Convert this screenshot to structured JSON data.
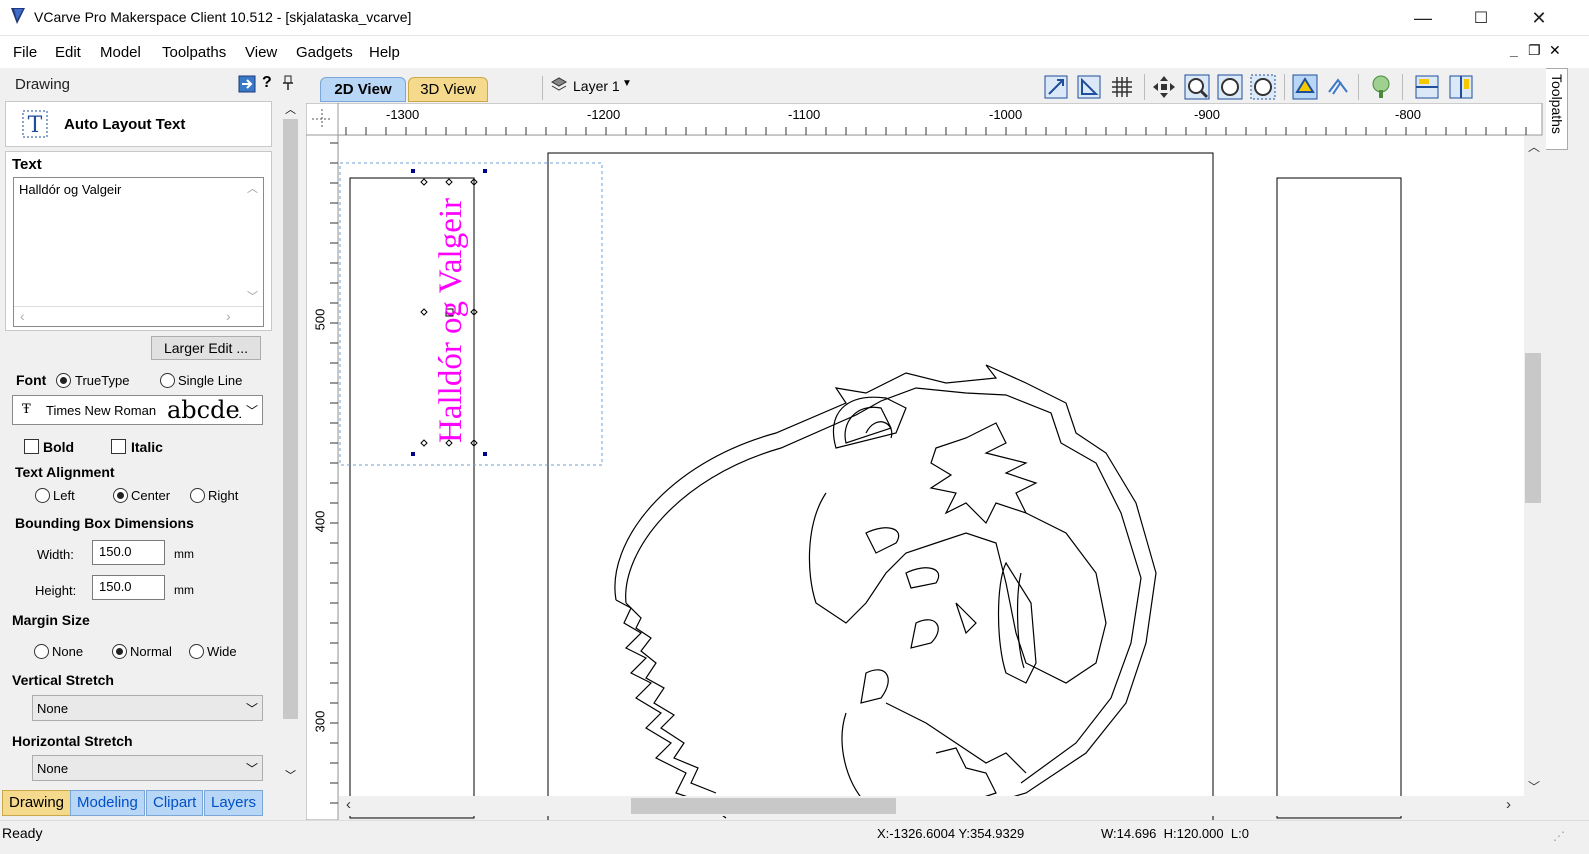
{
  "window": {
    "title": "VCarve Pro Makerspace Client 10.512 - [skjalataska_vcarve]",
    "minimize": "—",
    "maximize": "☐",
    "close": "✕"
  },
  "menu": [
    "File",
    "Edit",
    "Model",
    "Toolpaths",
    "View",
    "Gadgets",
    "Help"
  ],
  "mdi": {
    "minimize": "_",
    "restore": "❐",
    "close": "✕"
  },
  "panel": {
    "header": "Drawing",
    "help": "?",
    "pin": "📌",
    "tool_title": "Auto Layout Text",
    "text_section": "Text",
    "text_value": "Halldór og Valgeir",
    "larger_edit": "Larger Edit ...",
    "font_label": "Font",
    "font_truetype": "TrueType",
    "font_singleline": "Single Line",
    "font_name": "Times New Roman",
    "font_sample": "abcdeA",
    "bold": "Bold",
    "italic": "Italic",
    "text_alignment": "Text Alignment",
    "align_left": "Left",
    "align_center": "Center",
    "align_right": "Right",
    "bbox_dims": "Bounding Box Dimensions",
    "width_label": "Width:",
    "width_value": "150.0",
    "width_unit": "mm",
    "height_label": "Height:",
    "height_value": "150.0",
    "height_unit": "mm",
    "margin_size": "Margin Size",
    "margin_none": "None",
    "margin_normal": "Normal",
    "margin_wide": "Wide",
    "vertical_stretch": "Vertical Stretch",
    "vertical_value": "None",
    "horizontal_stretch": "Horizontal Stretch",
    "horizontal_value": "None"
  },
  "bottom_tabs": [
    "Drawing",
    "Modeling",
    "Clipart",
    "Layers"
  ],
  "view_tabs": {
    "tab2d": "2D View",
    "tab3d": "3D View"
  },
  "layer": "Layer 1",
  "right_tab": "Toolpaths",
  "ruler": {
    "h_labels": [
      "-1300",
      "-1200",
      "-1100",
      "-1000",
      "-900",
      "-800"
    ],
    "v_labels": [
      "500",
      "400",
      "300"
    ]
  },
  "canvas_text": "Halldór og Valgeir",
  "status": {
    "left": "Ready",
    "coords": "X:-1326.6004 Y:354.9329",
    "dims": "W:14.696  H:120.000  L:0"
  },
  "colors": {
    "accent": "#ff00ff",
    "tab_active": "#b8d6f5",
    "tab_3d": "#f5d98c",
    "selection": "#00008b"
  }
}
